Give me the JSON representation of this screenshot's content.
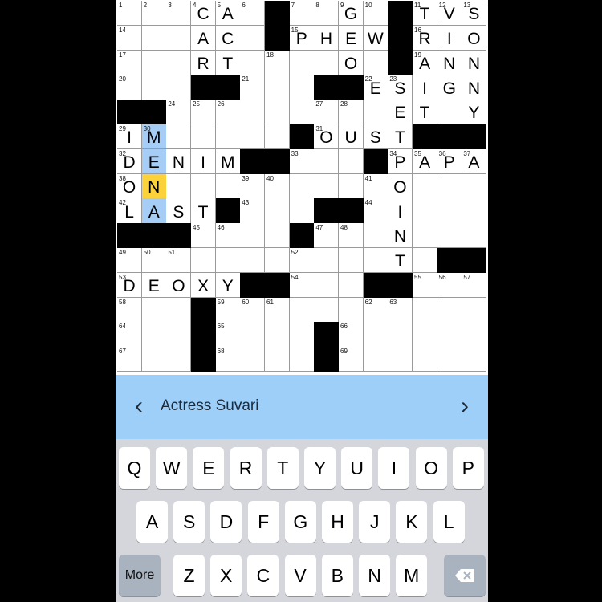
{
  "puzzle": {
    "rows": 15,
    "cols": 15,
    "cells": [
      [
        "1",
        "2",
        "3",
        "4:C",
        "5:A",
        "6",
        "#",
        "7",
        "8",
        "9:G",
        "10",
        "#",
        "11:T",
        "12:V",
        "13:S"
      ],
      [
        "14",
        "",
        "",
        ":A",
        ":C",
        "",
        "#",
        "15:P",
        ":H",
        ":E",
        ":W",
        "#",
        "16:R",
        ":I",
        ":O"
      ],
      [
        "17",
        "",
        "",
        ":R",
        ":T",
        "",
        "18",
        "",
        "",
        ":O",
        "",
        "#",
        "19:A",
        ":N",
        ":N"
      ],
      [
        "20",
        "",
        "",
        "#",
        "#",
        "21",
        "",
        "",
        "#",
        "#",
        "22:E",
        "23:S",
        ":I",
        ":G",
        ":N"
      ],
      [
        "#",
        "#",
        "24",
        "25",
        "26",
        "",
        "",
        "",
        "27",
        "28",
        "",
        ":E",
        ":T",
        "",
        ":Y"
      ],
      [
        "29:I",
        "30:M",
        "",
        "",
        "",
        "",
        "",
        "#",
        "31:O",
        ":U",
        ":S",
        ":T",
        "#",
        "#",
        "#"
      ],
      [
        "32:D",
        ":E",
        ":N",
        ":I",
        ":M",
        "#",
        "#",
        "33",
        "",
        "",
        "#",
        "34:P",
        "35:A",
        "36:P",
        "37:A"
      ],
      [
        "38:O",
        ":N",
        "",
        "",
        "",
        "39",
        "40",
        "",
        "",
        "",
        "41",
        ":O",
        "",
        "",
        ""
      ],
      [
        "42:L",
        ":A",
        ":S",
        ":T",
        "#",
        "43",
        "",
        "",
        "#",
        "#",
        "44",
        ":I",
        "",
        "",
        ""
      ],
      [
        "#",
        "#",
        "#",
        "45",
        "46",
        "",
        "",
        "#",
        "47",
        "48",
        "",
        ":N",
        "",
        "",
        ""
      ],
      [
        "49",
        "50",
        "51",
        "",
        "",
        "",
        "",
        "52",
        "",
        "",
        "",
        ":T",
        "",
        "#",
        "#"
      ],
      [
        "53:D",
        ":E",
        ":O",
        ":X",
        ":Y",
        "#",
        "#",
        "54",
        "",
        "",
        "#",
        "#",
        "55",
        "56",
        "57"
      ],
      [
        "58",
        "",
        "",
        "#",
        "59",
        "60",
        "61",
        "",
        "",
        "",
        "62",
        "63",
        "",
        "",
        ""
      ],
      [
        "64",
        "",
        "",
        "#",
        "65",
        "",
        "",
        "",
        "#",
        "66",
        "",
        "",
        "",
        "",
        ""
      ],
      [
        "67",
        "",
        "",
        "#",
        "68",
        "",
        "",
        "",
        "#",
        "69",
        "",
        "",
        "",
        "",
        ""
      ]
    ],
    "highlighted_word": [
      [
        5,
        1
      ],
      [
        6,
        1
      ],
      [
        7,
        1
      ],
      [
        8,
        1
      ]
    ],
    "active_cell": [
      7,
      1
    ],
    "colors": {
      "word_highlight": "#a6cdf5",
      "active_cell": "#fcd23a",
      "clue_bar": "#9ecff8"
    }
  },
  "clue_bar": {
    "prev_icon": "‹",
    "text": "Actress Suvari",
    "next_icon": "›"
  },
  "keyboard": {
    "row1": [
      "Q",
      "W",
      "E",
      "R",
      "T",
      "Y",
      "U",
      "I",
      "O",
      "P"
    ],
    "row2": [
      "A",
      "S",
      "D",
      "F",
      "G",
      "H",
      "J",
      "K",
      "L"
    ],
    "row3": [
      "Z",
      "X",
      "C",
      "V",
      "B",
      "N",
      "M"
    ],
    "more_label": "More",
    "backspace_icon": "backspace-icon"
  }
}
